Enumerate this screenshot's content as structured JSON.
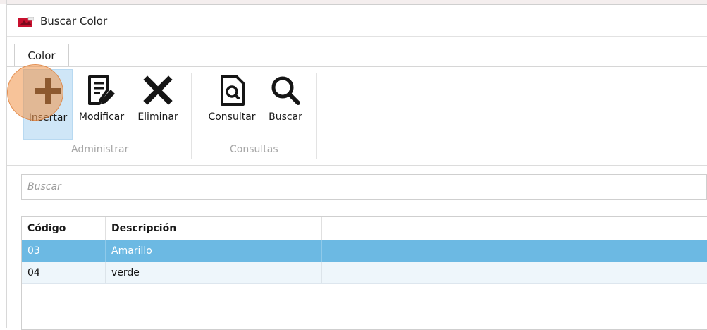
{
  "window": {
    "title": "Buscar Color",
    "icon": "app-icon"
  },
  "ribbon": {
    "tab": "Color",
    "buttons": [
      {
        "label": "Insertar",
        "icon": "plus-icon",
        "active": true
      },
      {
        "label": "Modificar",
        "icon": "edit-document-icon"
      },
      {
        "label": "Eliminar",
        "icon": "close-x-icon"
      },
      {
        "label": "Consultar",
        "icon": "document-search-icon"
      },
      {
        "label": "Buscar",
        "icon": "magnifier-icon"
      }
    ],
    "groups": [
      {
        "label": "Administrar"
      },
      {
        "label": "Consultas"
      }
    ]
  },
  "search": {
    "placeholder": "Buscar",
    "value": ""
  },
  "grid": {
    "columns": [
      "Código",
      "Descripción"
    ],
    "rows": [
      {
        "codigo": "03",
        "descripcion": "Amarillo",
        "selected": true
      },
      {
        "codigo": "04",
        "descripcion": "verde",
        "selected": false
      }
    ]
  },
  "colors": {
    "selected_row": "#6cb9e3",
    "active_button": "#cfe6f7",
    "cursor_highlight": "#f0914a"
  }
}
